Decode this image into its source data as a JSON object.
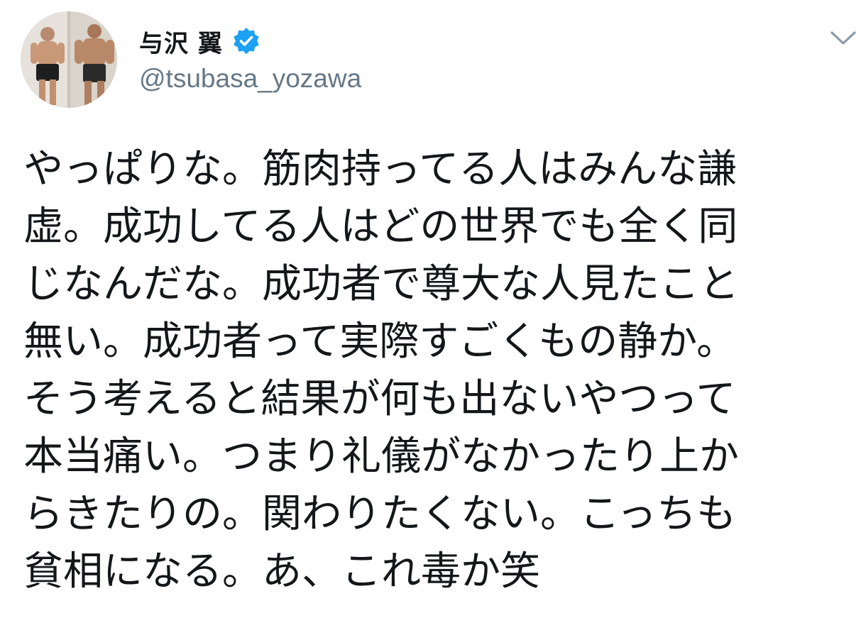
{
  "author": {
    "display_name": "与沢 翼",
    "handle": "@tsubasa_yozawa",
    "verified": true
  },
  "icons": {
    "verified": "verified-badge-icon",
    "menu": "chevron-down-icon"
  },
  "colors": {
    "verified_blue": "#1da1f2",
    "handle_gray": "#657786",
    "text": "#14171a"
  },
  "tweet": {
    "lines": [
      "やっぱりな。筋肉持ってる人はみんな謙",
      "虚。成功してる人はどの世界でも全く同",
      "じなんだな。成功者で尊大な人見たこと",
      "無い。成功者って実際すごくもの静か。",
      "そう考えると結果が何も出ないやつって",
      "本当痛い。つまり礼儀がなかったり上か",
      "らきたりの。関わりたくない。こっちも",
      "貧相になる。あ、これ毒か笑"
    ]
  }
}
